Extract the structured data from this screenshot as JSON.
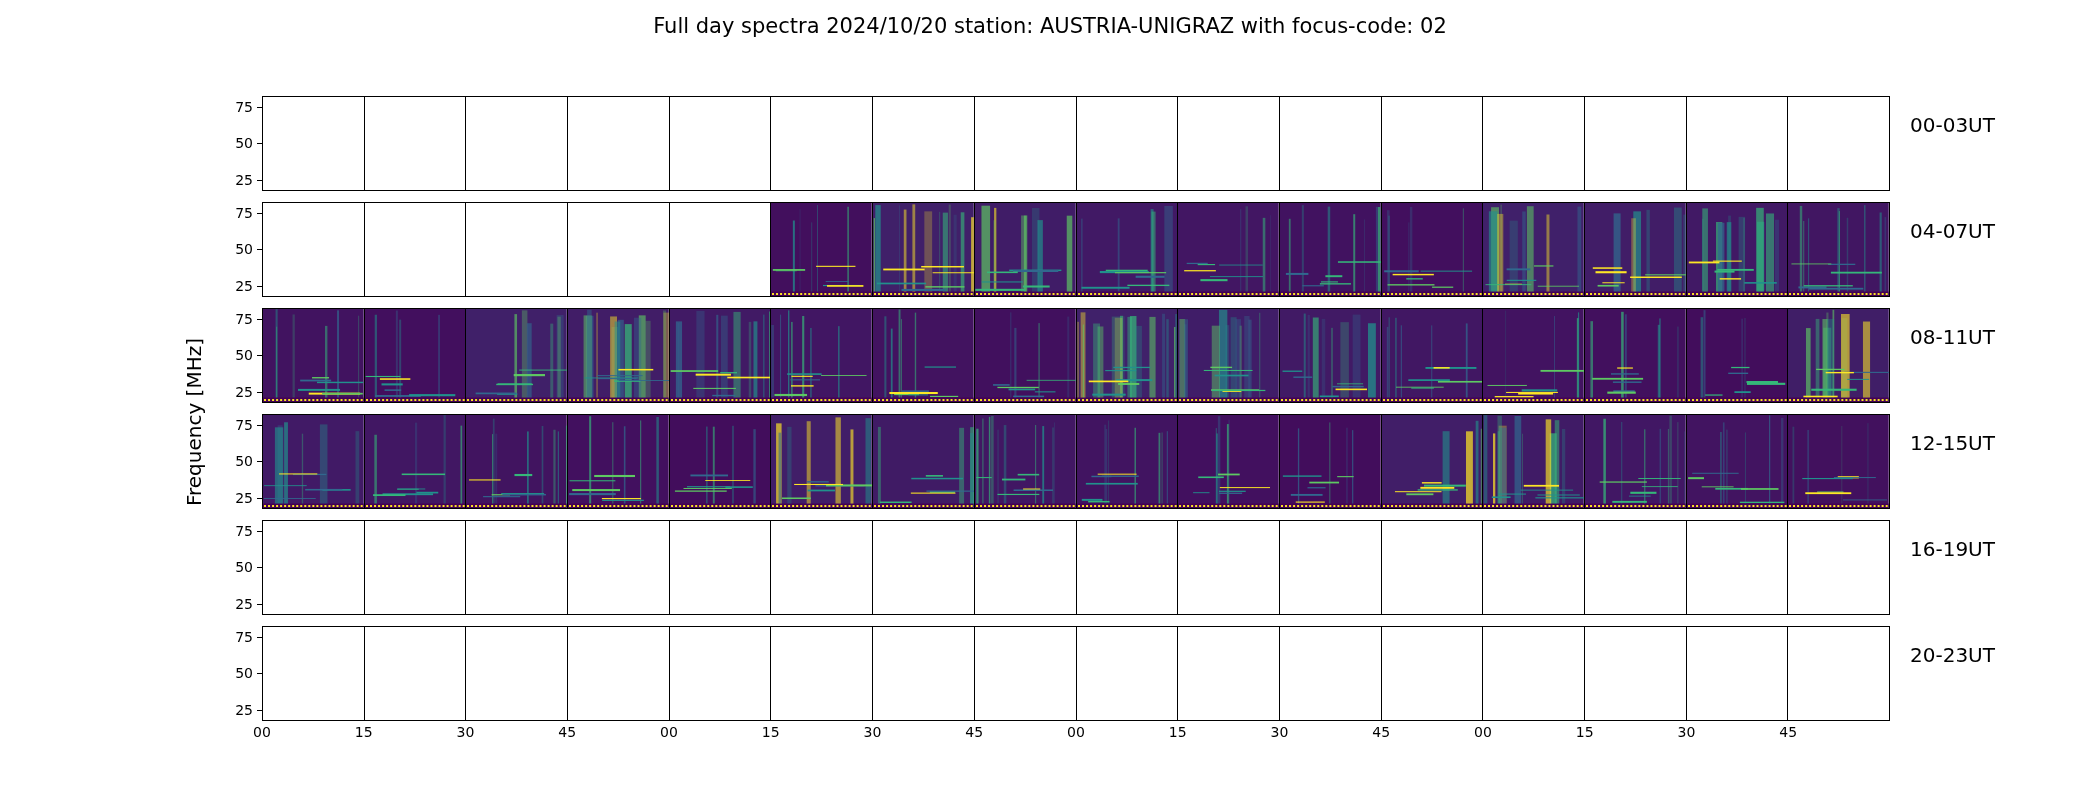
{
  "title": "Full day spectra 2024/10/20 station: AUSTRIA-UNIGRAZ with focus-code: 02",
  "y_axis": {
    "label": "Frequency [MHz]"
  },
  "rows": [
    {
      "label": "00-03UT",
      "yticks": [
        "75",
        "50",
        "25"
      ],
      "panels": [
        {
          "kind": "empty"
        },
        {
          "kind": "empty"
        },
        {
          "kind": "empty"
        },
        {
          "kind": "empty"
        },
        {
          "kind": "empty"
        },
        {
          "kind": "empty"
        },
        {
          "kind": "empty"
        },
        {
          "kind": "empty"
        },
        {
          "kind": "empty"
        },
        {
          "kind": "empty"
        },
        {
          "kind": "empty"
        },
        {
          "kind": "empty"
        },
        {
          "kind": "empty"
        },
        {
          "kind": "empty"
        },
        {
          "kind": "empty"
        },
        {
          "kind": "empty"
        }
      ]
    },
    {
      "label": "04-07UT",
      "yticks": [
        "75",
        "50",
        "25"
      ],
      "panels": [
        {
          "kind": "empty"
        },
        {
          "kind": "empty"
        },
        {
          "kind": "empty"
        },
        {
          "kind": "empty"
        },
        {
          "kind": "empty"
        },
        {
          "kind": "spectrum"
        },
        {
          "kind": "spectrum"
        },
        {
          "kind": "spectrum"
        },
        {
          "kind": "spectrum"
        },
        {
          "kind": "spectrum"
        },
        {
          "kind": "spectrum"
        },
        {
          "kind": "spectrum"
        },
        {
          "kind": "spectrum"
        },
        {
          "kind": "spectrum"
        },
        {
          "kind": "spectrum"
        },
        {
          "kind": "spectrum"
        }
      ]
    },
    {
      "label": "08-11UT",
      "yticks": [
        "75",
        "50",
        "25"
      ],
      "panels": [
        {
          "kind": "spectrum"
        },
        {
          "kind": "spectrum"
        },
        {
          "kind": "spectrum"
        },
        {
          "kind": "spectrum"
        },
        {
          "kind": "spectrum"
        },
        {
          "kind": "spectrum"
        },
        {
          "kind": "spectrum"
        },
        {
          "kind": "spectrum"
        },
        {
          "kind": "spectrum"
        },
        {
          "kind": "spectrum"
        },
        {
          "kind": "spectrum"
        },
        {
          "kind": "spectrum"
        },
        {
          "kind": "spectrum"
        },
        {
          "kind": "spectrum"
        },
        {
          "kind": "spectrum"
        },
        {
          "kind": "spectrum"
        }
      ]
    },
    {
      "label": "12-15UT",
      "yticks": [
        "75",
        "50",
        "25"
      ],
      "panels": [
        {
          "kind": "spectrum"
        },
        {
          "kind": "spectrum"
        },
        {
          "kind": "spectrum"
        },
        {
          "kind": "spectrum"
        },
        {
          "kind": "spectrum"
        },
        {
          "kind": "spectrum"
        },
        {
          "kind": "spectrum"
        },
        {
          "kind": "spectrum"
        },
        {
          "kind": "spectrum"
        },
        {
          "kind": "spectrum"
        },
        {
          "kind": "spectrum"
        },
        {
          "kind": "spectrum"
        },
        {
          "kind": "spectrum"
        },
        {
          "kind": "spectrum"
        },
        {
          "kind": "spectrum"
        },
        {
          "kind": "spectrum"
        }
      ]
    },
    {
      "label": "16-19UT",
      "yticks": [
        "75",
        "50",
        "25"
      ],
      "panels": [
        {
          "kind": "empty"
        },
        {
          "kind": "empty"
        },
        {
          "kind": "empty"
        },
        {
          "kind": "empty"
        },
        {
          "kind": "empty"
        },
        {
          "kind": "empty"
        },
        {
          "kind": "empty"
        },
        {
          "kind": "empty"
        },
        {
          "kind": "empty"
        },
        {
          "kind": "empty"
        },
        {
          "kind": "empty"
        },
        {
          "kind": "empty"
        },
        {
          "kind": "empty"
        },
        {
          "kind": "empty"
        },
        {
          "kind": "empty"
        },
        {
          "kind": "empty"
        }
      ]
    },
    {
      "label": "20-23UT",
      "yticks": [
        "75",
        "50",
        "25"
      ],
      "panels": [
        {
          "kind": "empty"
        },
        {
          "kind": "empty"
        },
        {
          "kind": "empty"
        },
        {
          "kind": "empty"
        },
        {
          "kind": "empty"
        },
        {
          "kind": "empty"
        },
        {
          "kind": "empty"
        },
        {
          "kind": "empty"
        },
        {
          "kind": "empty"
        },
        {
          "kind": "empty"
        },
        {
          "kind": "empty"
        },
        {
          "kind": "empty"
        },
        {
          "kind": "empty"
        },
        {
          "kind": "empty"
        },
        {
          "kind": "empty"
        },
        {
          "kind": "empty"
        }
      ]
    }
  ],
  "x_axis": {
    "ticks": [
      "00",
      "15",
      "30",
      "45",
      "00",
      "15",
      "30",
      "45",
      "00",
      "15",
      "30",
      "45",
      "00",
      "15",
      "30",
      "45"
    ]
  }
}
